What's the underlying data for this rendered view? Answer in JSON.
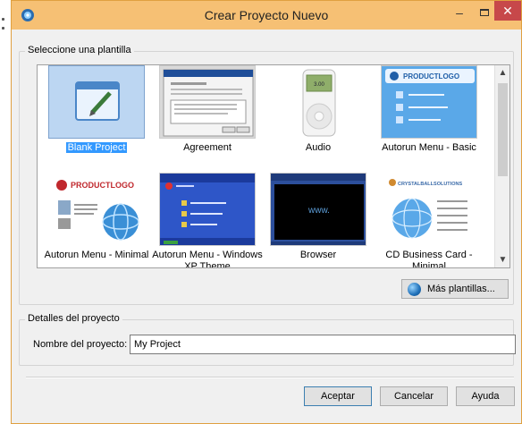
{
  "window": {
    "title": "Crear Proyecto Nuevo",
    "minimize": "–",
    "close": "✕"
  },
  "templates_group": {
    "label": "Seleccione una plantilla",
    "items": [
      {
        "label": "Blank Project",
        "selected": true
      },
      {
        "label": "Agreement"
      },
      {
        "label": "Audio"
      },
      {
        "label": "Autorun Menu - Basic"
      },
      {
        "label": "Autorun Menu - Minimal"
      },
      {
        "label": "Autorun Menu - Windows XP Theme"
      },
      {
        "label": "Browser"
      },
      {
        "label": "CD Business Card - Minimal"
      }
    ],
    "audio_screen": "3.00",
    "browser_screen": "www.",
    "logo_text": "PRODUCTLOGO",
    "crystal_logo": "CRYSTALBALLSOLUTIONS",
    "more_button": "Más plantillas..."
  },
  "details_group": {
    "label": "Detalles del proyecto",
    "name_label": "Nombre del proyecto:",
    "name_value": "My Project"
  },
  "buttons": {
    "ok": "Aceptar",
    "cancel": "Cancelar",
    "help": "Ayuda"
  },
  "colors": {
    "titlebar": "#f6c074",
    "close": "#c7484a",
    "selection": "#3399ff"
  }
}
